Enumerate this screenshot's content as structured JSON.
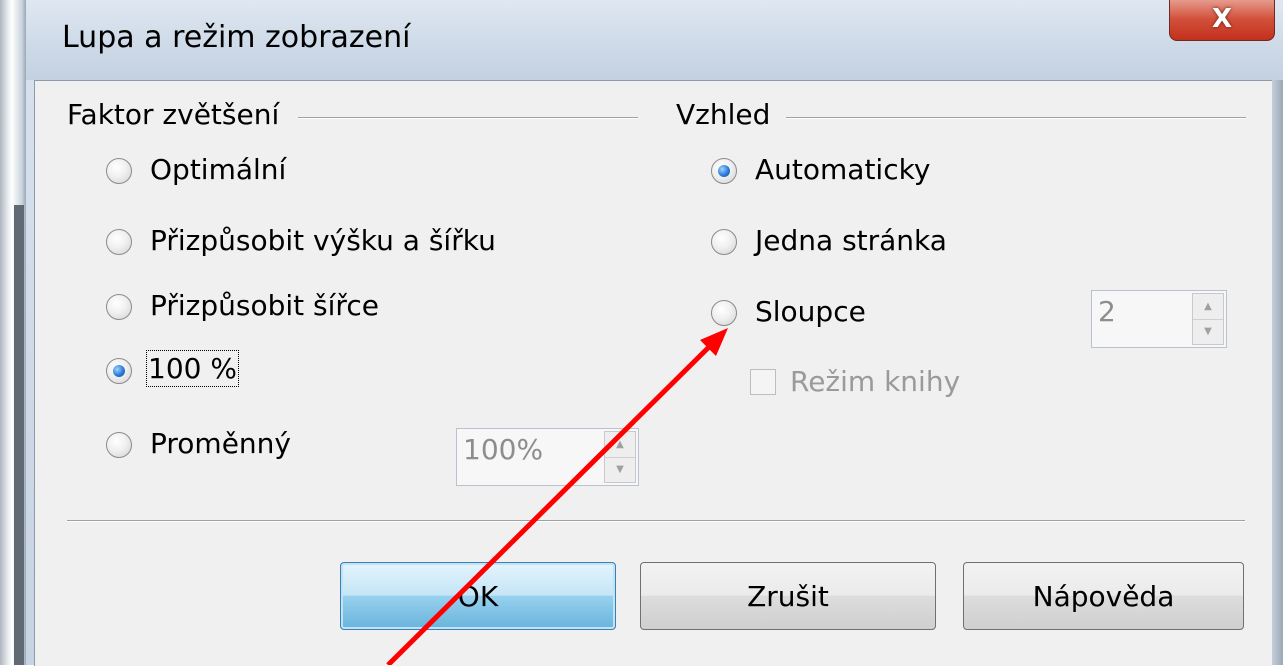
{
  "window": {
    "title": "Lupa a režim zobrazení",
    "close_glyph": "X"
  },
  "zoom_group": {
    "label": "Faktor zvětšení",
    "options": [
      {
        "label": "Optimální",
        "checked": false
      },
      {
        "label": "Přizpůsobit výšku a šířku",
        "checked": false
      },
      {
        "label": "Přizpůsobit šířce",
        "checked": false
      },
      {
        "label": "100 %",
        "checked": true
      },
      {
        "label": "Proměnný",
        "checked": false
      }
    ],
    "variable_value": "100%"
  },
  "view_group": {
    "label": "Vzhled",
    "options": [
      {
        "label": "Automaticky",
        "checked": true
      },
      {
        "label": "Jedna stránka",
        "checked": false
      },
      {
        "label": "Sloupce",
        "checked": false
      }
    ],
    "columns_value": "2",
    "book_mode_label": "Režim knihy",
    "book_mode_checked": false
  },
  "buttons": {
    "ok": "OK",
    "cancel": "Zrušit",
    "help": "Nápověda"
  },
  "annotation": {
    "color": "#ff0000",
    "target": "Sloupce radio button"
  },
  "colors": {
    "close_button": "#c3301c",
    "default_button": "#68b3db",
    "radio_dot": "#2a7bd8"
  }
}
